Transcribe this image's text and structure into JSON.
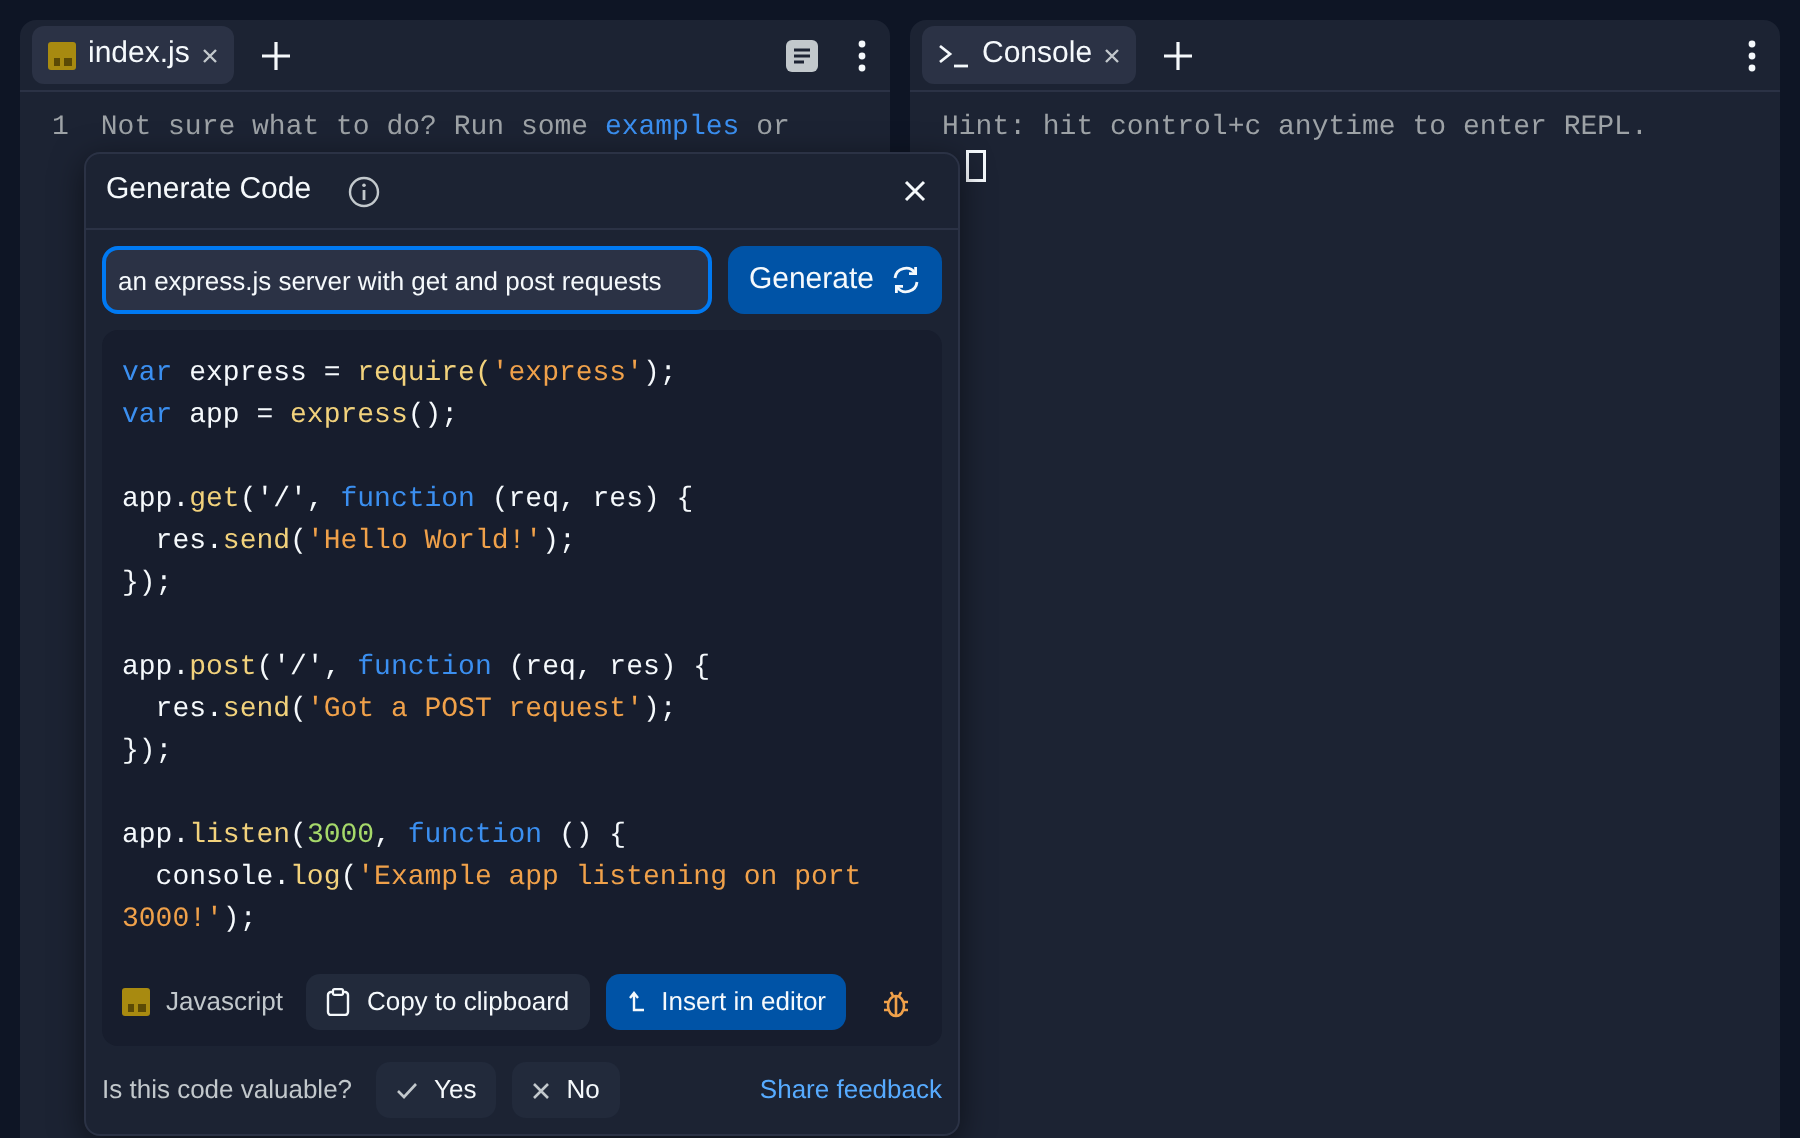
{
  "editor": {
    "tabs": [
      {
        "label": "index.js",
        "selected": true
      }
    ],
    "lines": [
      {
        "number": "1",
        "parts": [
          {
            "text": "Not sure what to do? Run some ",
            "kind": "hint"
          },
          {
            "text": "examples",
            "kind": "link"
          },
          {
            "text": " or",
            "kind": "hint"
          }
        ]
      }
    ]
  },
  "console": {
    "tabs": [
      {
        "label": "Console",
        "selected": true
      }
    ],
    "output": "Hint: hit control+c anytime to enter REPL."
  },
  "dialog": {
    "title": "Generate Code",
    "prompt": "an express.js server with get and post requests",
    "generate_button": "Generate",
    "code_blocks": [
      {
        "lines": [
          {
            "tokens": [
              {
                "t": "var",
                "kind": "keyword"
              },
              {
                "t": " express = ",
                "kind": "plain"
              },
              {
                "t": "require(",
                "kind": "func"
              },
              {
                "t": "'express'",
                "kind": "string"
              },
              {
                "t": ");",
                "kind": "plain"
              }
            ]
          },
          {
            "tokens": [
              {
                "t": "var",
                "kind": "keyword"
              },
              {
                "t": " app = ",
                "kind": "plain"
              },
              {
                "t": "express",
                "kind": "func"
              },
              {
                "t": "();",
                "kind": "plain"
              }
            ]
          }
        ]
      },
      {
        "lines": [
          {
            "tokens": [
              {
                "t": "app.",
                "kind": "plain"
              },
              {
                "t": "get",
                "kind": "func"
              },
              {
                "t": "('/', ",
                "kind": "plain"
              },
              {
                "t": "function",
                "kind": "keyword"
              },
              {
                "t": " (req, res) {",
                "kind": "plain"
              }
            ]
          },
          {
            "tokens": [
              {
                "t": "  res.",
                "kind": "plain"
              },
              {
                "t": "send",
                "kind": "func"
              },
              {
                "t": "(",
                "kind": "plain"
              },
              {
                "t": "'Hello World!'",
                "kind": "string"
              },
              {
                "t": ");",
                "kind": "plain"
              }
            ]
          },
          {
            "tokens": [
              {
                "t": "});",
                "kind": "plain"
              }
            ]
          }
        ]
      },
      {
        "lines": [
          {
            "tokens": [
              {
                "t": "app.",
                "kind": "plain"
              },
              {
                "t": "post",
                "kind": "func"
              },
              {
                "t": "('/', ",
                "kind": "plain"
              },
              {
                "t": "function",
                "kind": "keyword"
              },
              {
                "t": " (req, res) {",
                "kind": "plain"
              }
            ]
          },
          {
            "tokens": [
              {
                "t": "  res.",
                "kind": "plain"
              },
              {
                "t": "send",
                "kind": "func"
              },
              {
                "t": "(",
                "kind": "plain"
              },
              {
                "t": "'Got a POST request'",
                "kind": "string"
              },
              {
                "t": ");",
                "kind": "plain"
              }
            ]
          },
          {
            "tokens": [
              {
                "t": "});",
                "kind": "plain"
              }
            ]
          }
        ]
      },
      {
        "lines": [
          {
            "tokens": [
              {
                "t": "app.",
                "kind": "plain"
              },
              {
                "t": "listen",
                "kind": "func"
              },
              {
                "t": "(",
                "kind": "plain"
              },
              {
                "t": "3000",
                "kind": "number"
              },
              {
                "t": ", ",
                "kind": "plain"
              },
              {
                "t": "function",
                "kind": "keyword"
              },
              {
                "t": " () {",
                "kind": "plain"
              }
            ]
          },
          {
            "tokens": [
              {
                "t": "  console.",
                "kind": "plain"
              },
              {
                "t": "log",
                "kind": "func"
              },
              {
                "t": "(",
                "kind": "plain"
              },
              {
                "t": "'Example app listening on port",
                "kind": "string"
              }
            ]
          },
          {
            "tokens": [
              {
                "t": "3000!'",
                "kind": "string"
              },
              {
                "t": ");",
                "kind": "plain"
              }
            ]
          }
        ]
      }
    ],
    "language": "Javascript",
    "copy_button": "Copy to clipboard",
    "insert_button": "Insert in editor",
    "feedback_question": "Is this code valuable?",
    "yes_button": "Yes",
    "no_button": "No",
    "share_link": "Share feedback"
  }
}
